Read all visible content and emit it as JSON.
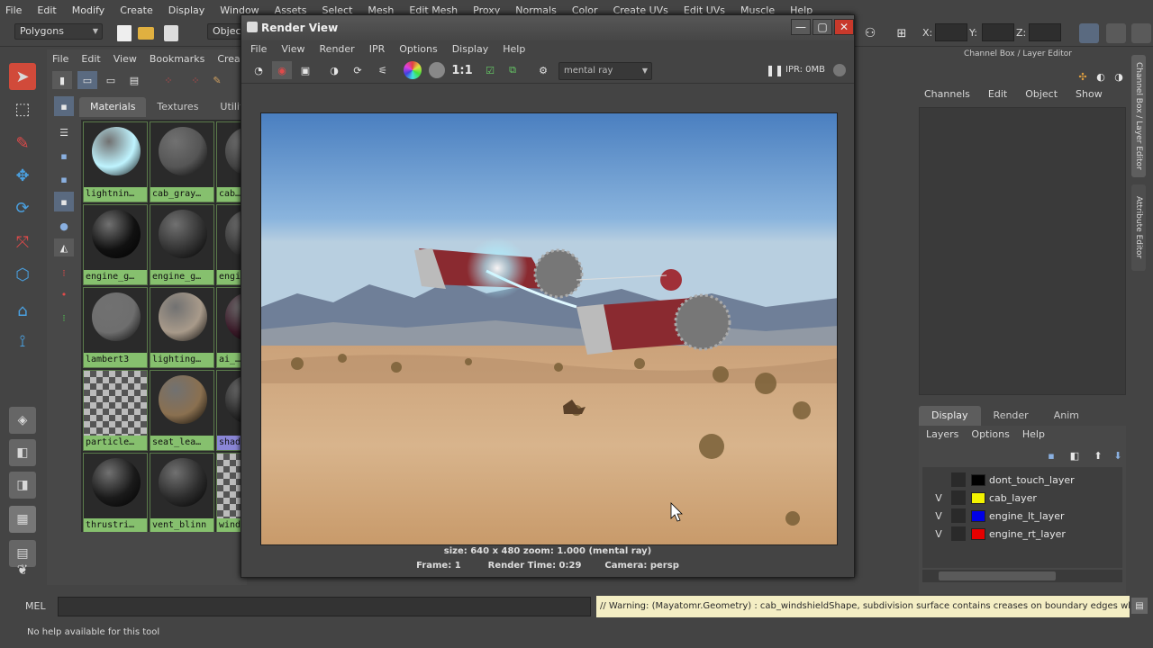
{
  "main_menu": [
    "File",
    "Edit",
    "Modify",
    "Create",
    "Display",
    "Window",
    "Assets",
    "Select",
    "Mesh",
    "Edit Mesh",
    "Proxy",
    "Normals",
    "Color",
    "Create UVs",
    "Edit UVs",
    "Muscle",
    "Help"
  ],
  "shelf": {
    "mode_dropdown": "Polygons",
    "objects_label": "Objects"
  },
  "coords": {
    "x_label": "X:",
    "y_label": "Y:",
    "z_label": "Z:"
  },
  "hypershade": {
    "menu": [
      "File",
      "Edit",
      "View",
      "Bookmarks",
      "Create"
    ],
    "tabs": [
      "Materials",
      "Textures",
      "Utilities"
    ],
    "swatches": [
      {
        "label": "lightnin…",
        "color": "#bff4ff"
      },
      {
        "label": "cab_gray…",
        "color": "#555555"
      },
      {
        "label": "cab…",
        "color": "#444444"
      },
      {
        "label": "engine_g…",
        "color": "#111111"
      },
      {
        "label": "engine_g…",
        "color": "#333333"
      },
      {
        "label": "engi…",
        "color": "#3a3a3a"
      },
      {
        "label": "lambert3",
        "color": "#6e6e6e"
      },
      {
        "label": "lighting…",
        "color": "#a89a8a"
      },
      {
        "label": "ai_…",
        "color": "#3a1a28"
      },
      {
        "label": "particle…",
        "color": "checker"
      },
      {
        "label": "seat_lea…",
        "color": "#8a7050"
      },
      {
        "label": "shad…",
        "color": "#2a2a2a"
      },
      {
        "label": "thrustri…",
        "color": "#1a1a1a"
      },
      {
        "label": "vent_blinn",
        "color": "#2c2c2c"
      },
      {
        "label": "wind…",
        "color": "checker"
      }
    ]
  },
  "render_view": {
    "title": "Render View",
    "menu": [
      "File",
      "View",
      "Render",
      "IPR",
      "Options",
      "Display",
      "Help"
    ],
    "ratio_label": "1:1",
    "renderer": "mental ray",
    "ipr_label": "IPR: 0MB",
    "info_line1": "size: 640 x 480  zoom: 1.000         (mental ray)",
    "frame": "Frame: 1",
    "render_time": "Render Time: 0:29",
    "camera": "Camera: persp"
  },
  "channel_box": {
    "title": "Channel Box / Layer Editor",
    "menu": [
      "Channels",
      "Edit",
      "Object",
      "Show"
    ],
    "side_tab1": "Channel Box / Layer Editor",
    "side_tab2": "Attribute Editor"
  },
  "layer_editor": {
    "tabs": [
      "Display",
      "Render",
      "Anim"
    ],
    "menu": [
      "Layers",
      "Options",
      "Help"
    ],
    "layers": [
      {
        "v": "",
        "name": "dont_touch_layer",
        "color": "#000000"
      },
      {
        "v": "V",
        "name": "cab_layer",
        "color": "#f2f200"
      },
      {
        "v": "V",
        "name": "engine_lt_layer",
        "color": "#0000e6"
      },
      {
        "v": "V",
        "name": "engine_rt_layer",
        "color": "#e60000"
      }
    ]
  },
  "command_line": {
    "label": "MEL",
    "warning": "// Warning: (Mayatomr.Geometry) : cab_windshieldShape, subdivision surface contains creases on boundary edges which"
  },
  "help_line": "No help available for this tool"
}
